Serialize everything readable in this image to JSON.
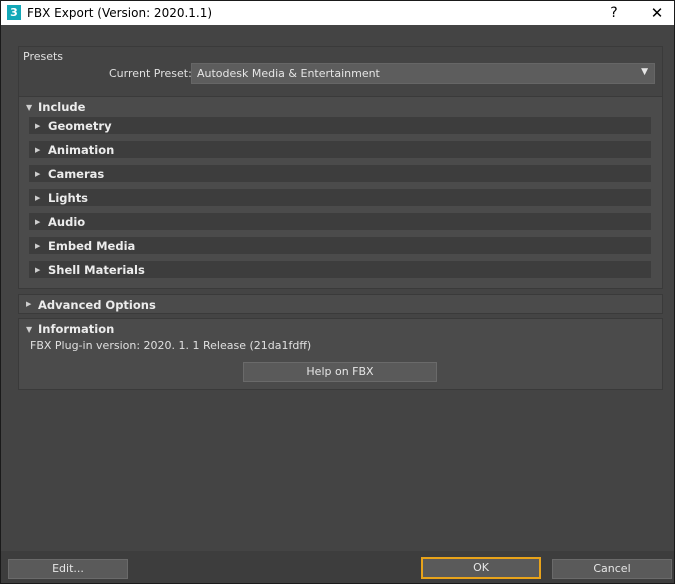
{
  "window": {
    "title": "FBX Export (Version: 2020.1.1)",
    "app_icon": "3",
    "help_glyph": "?",
    "close_glyph": "✕"
  },
  "presets": {
    "title": "Presets",
    "current_label": "Current Preset:",
    "current_value": "Autodesk Media & Entertainment"
  },
  "include": {
    "label": "Include",
    "expanded": true,
    "items": [
      {
        "label": "Geometry"
      },
      {
        "label": "Animation"
      },
      {
        "label": "Cameras"
      },
      {
        "label": "Lights"
      },
      {
        "label": "Audio"
      },
      {
        "label": "Embed Media"
      },
      {
        "label": "Shell Materials"
      }
    ]
  },
  "advanced": {
    "label": "Advanced Options",
    "expanded": false
  },
  "information": {
    "label": "Information",
    "expanded": true,
    "plugin_version": "FBX Plug-in version: 2020. 1. 1 Release (21da1fdff)",
    "help_button": "Help on FBX"
  },
  "footer": {
    "edit": "Edit...",
    "ok": "OK",
    "cancel": "Cancel"
  },
  "colors": {
    "background": "#444444",
    "focus_border": "#e8a31a",
    "title_bar": "#ffffff"
  }
}
